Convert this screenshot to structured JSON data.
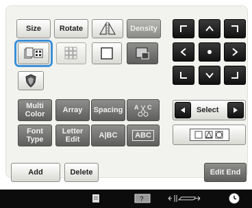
{
  "edit": {
    "size_label": "Size",
    "rotate_label": "Rotate",
    "density_label": "Density",
    "multi_color_label": "Multi\nColor",
    "array_label": "Array",
    "spacing_label": "Spacing",
    "font_type_label": "Font\nType",
    "letter_edit_label": "Letter\nEdit",
    "abc_shape_label": "A|BC",
    "abc_frame_label": "ABC"
  },
  "select_pad": {
    "select_label": "Select"
  },
  "footer": {
    "add_label": "Add",
    "delete_label": "Delete",
    "edit_end_label": "Edit End"
  },
  "status": {
    "icons": [
      "page-icon",
      "pattern-icon",
      "presser-foot-icon",
      "clock-icon"
    ]
  },
  "colors": {
    "selection_ring": "#3a8fd8",
    "dark_button": "#111111",
    "gray_button": "#5e5e5c"
  }
}
